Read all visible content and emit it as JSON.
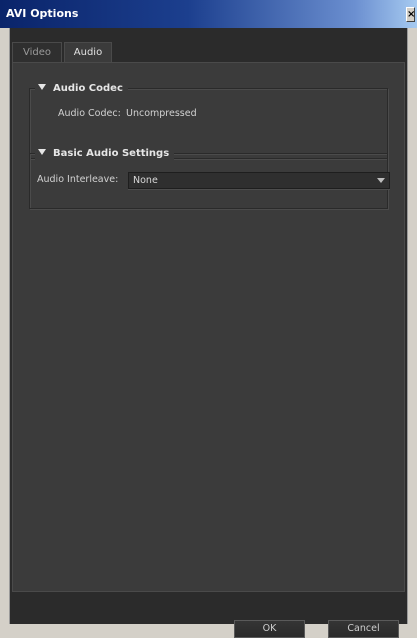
{
  "window": {
    "title": "AVI Options",
    "close_glyph": "✕"
  },
  "tabs": [
    {
      "label": "Video",
      "selected": false
    },
    {
      "label": "Audio",
      "selected": true
    }
  ],
  "audio_codec_group": {
    "title": "Audio Codec",
    "field_label": "Audio Codec:",
    "field_value": "Uncompressed"
  },
  "basic_audio_group": {
    "title": "Basic Audio Settings",
    "interleave_label": "Audio Interleave:",
    "interleave_value": "None"
  },
  "buttons": {
    "ok": "OK",
    "cancel": "Cancel"
  },
  "colors": {
    "panel": "#3b3b3b",
    "titlebar": "#0a246a",
    "text": "#d2d2d2"
  }
}
